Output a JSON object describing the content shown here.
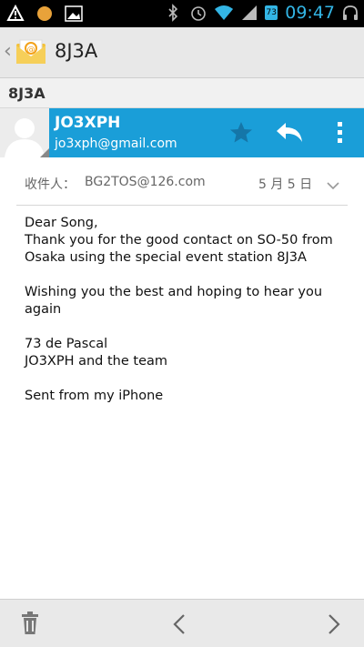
{
  "status_bar": {
    "time": "09:47",
    "badge": "73",
    "icons": [
      "warning-icon",
      "notification-dot-icon",
      "image-icon",
      "bluetooth-icon",
      "alarm-icon",
      "wifi-icon",
      "signal-icon",
      "battery-icon",
      "headset-icon"
    ]
  },
  "action_bar": {
    "title": "8J3A",
    "app_icon": "email-app-icon"
  },
  "subject": "8J3A",
  "sender": {
    "name": "JO3XPH",
    "email": "jo3xph@gmail.com"
  },
  "recipient": {
    "label": "收件人：",
    "address": "BG2TOS@126.com",
    "date": "5 月 5 日"
  },
  "body": {
    "line1": "Dear Song,",
    "line2": "Thank you for the good contact on SO-50 from",
    "line3": "Osaka using the special event station 8J3A",
    "line4": "Wishing you the best and hoping to hear you",
    "line5": "again",
    "line6": "73 de Pascal",
    "line7": "JO3XPH and the team",
    "line8": "Sent from my iPhone"
  },
  "colors": {
    "accent": "#1a9ed8",
    "status_time": "#33b5e5"
  }
}
